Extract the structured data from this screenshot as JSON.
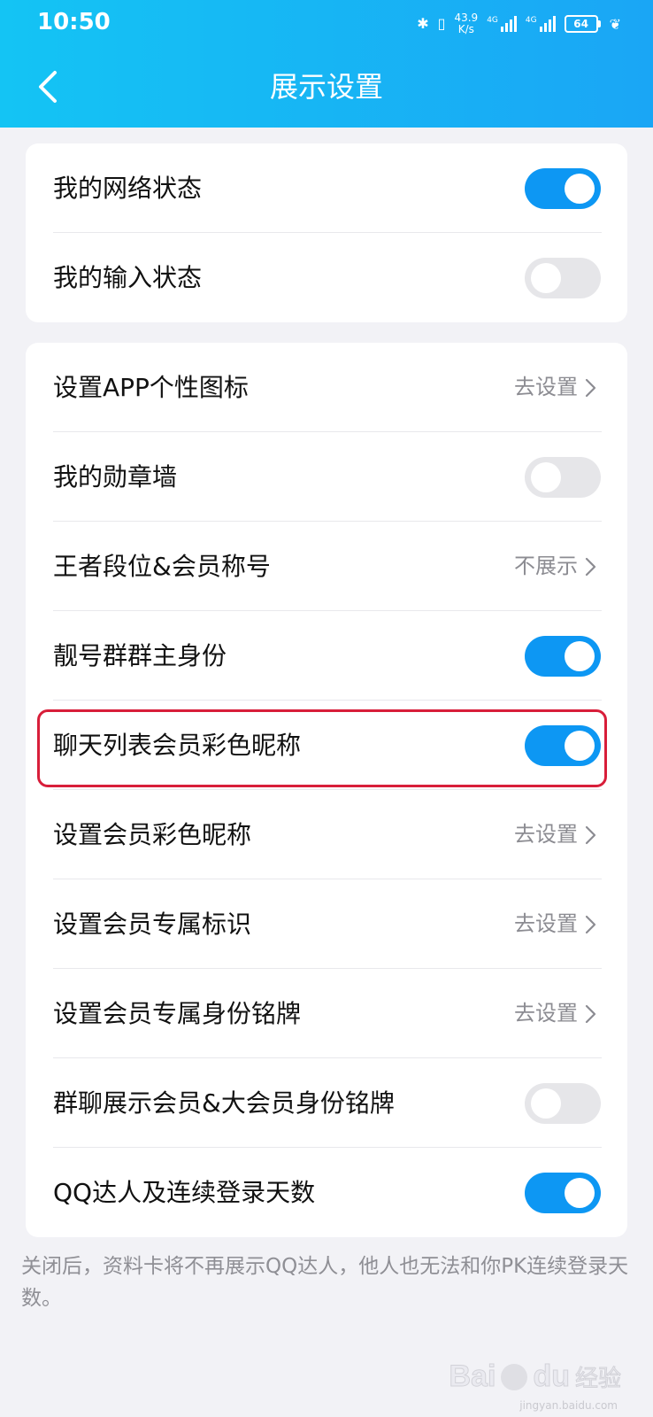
{
  "status_bar": {
    "time": "10:50",
    "speed_value": "43.9",
    "speed_unit": "K/s",
    "net1": "4G",
    "net2": "4G",
    "battery": "64"
  },
  "header": {
    "title": "展示设置"
  },
  "section1": {
    "rows": [
      {
        "label": "我的网络状态",
        "toggle_on": true
      },
      {
        "label": "我的输入状态",
        "toggle_on": false
      }
    ]
  },
  "section2": {
    "rows": [
      {
        "label": "设置APP个性图标",
        "value": "去设置"
      },
      {
        "label": "我的勋章墙",
        "toggle_on": false
      },
      {
        "label": "王者段位&会员称号",
        "value": "不展示"
      },
      {
        "label": "靓号群群主身份",
        "toggle_on": true
      },
      {
        "label": "聊天列表会员彩色昵称",
        "toggle_on": true
      },
      {
        "label": "设置会员彩色昵称",
        "value": "去设置"
      },
      {
        "label": "设置会员专属标识",
        "value": "去设置"
      },
      {
        "label": "设置会员专属身份铭牌",
        "value": "去设置"
      },
      {
        "label": "群聊展示会员&大会员身份铭牌",
        "toggle_on": false
      },
      {
        "label": "QQ达人及连续登录天数",
        "toggle_on": true
      }
    ]
  },
  "footer_note": "关闭后，资料卡将不再展示QQ达人，他人也无法和你PK连续登录天数。",
  "watermark": {
    "logo": "Bai",
    "logo2": "du",
    "sub": "经验",
    "url": "jingyan.baidu.com"
  },
  "colors": {
    "header_start": "#14c4f4",
    "header_end": "#1aa6f5",
    "toggle_on": "#0d97f3",
    "toggle_off": "#e6e6e9",
    "highlight": "#d81e3a"
  }
}
